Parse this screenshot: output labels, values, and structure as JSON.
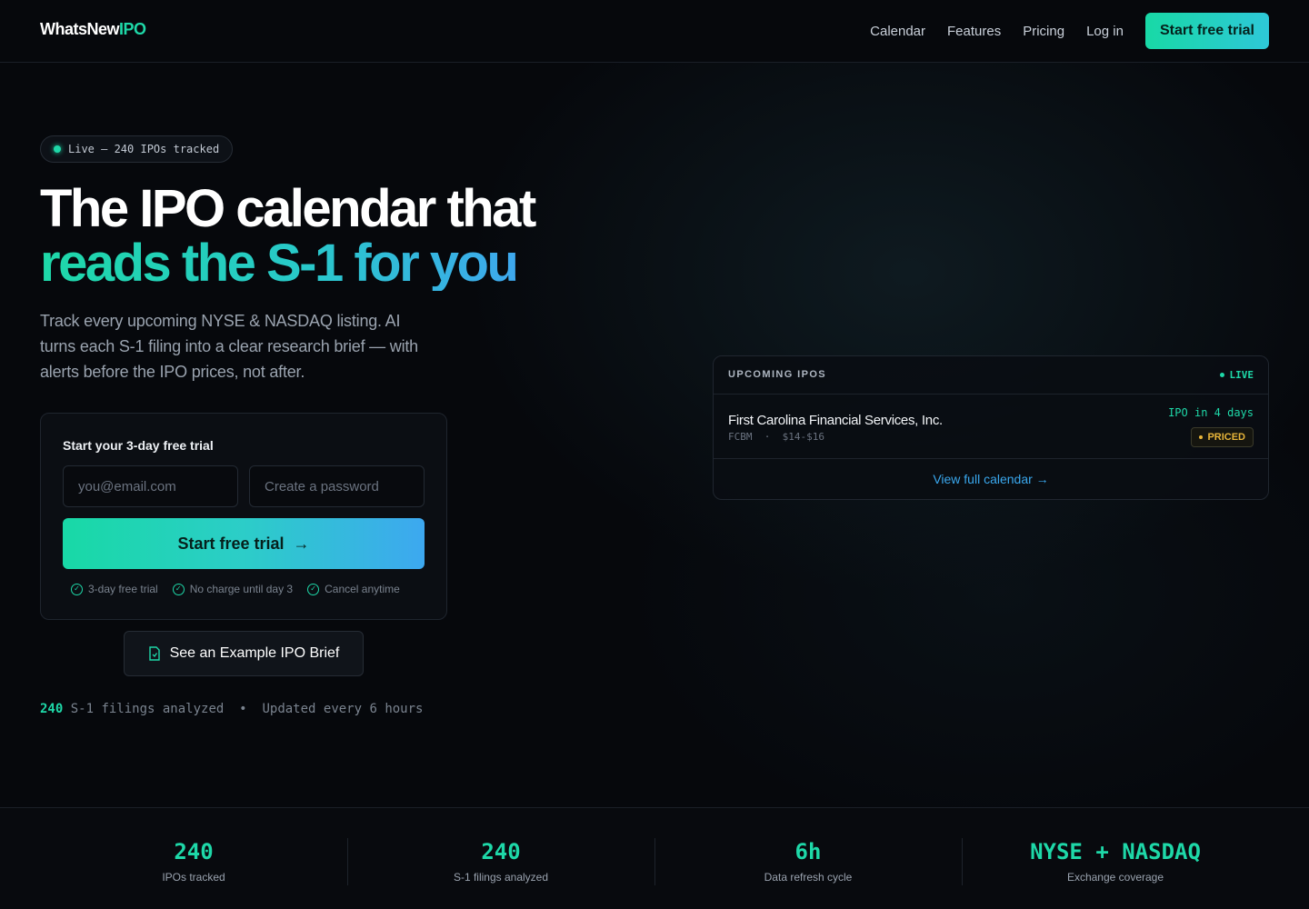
{
  "nav": {
    "logo_main": "WhatsNew",
    "logo_accent": "IPO",
    "links": [
      "Calendar",
      "Features",
      "Pricing",
      "Log in"
    ],
    "cta": "Start free trial"
  },
  "hero": {
    "live_badge": "Live — 240 IPOs tracked",
    "headline_line1": "The IPO calendar that",
    "headline_line2": "reads the S-1 for you",
    "subhead": "Track every upcoming NYSE & NASDAQ listing. AI turns each S-1 filing into a clear research brief — with alerts before the IPO prices, not after."
  },
  "signup": {
    "title": "Start your 3-day free trial",
    "email_placeholder": "you@email.com",
    "password_placeholder": "Create a password",
    "button_label": "Start free trial",
    "perks": [
      "3-day free trial",
      "No charge until day 3",
      "Cancel anytime"
    ]
  },
  "example_button": "See an Example IPO Brief",
  "stats_line": {
    "count": "240",
    "text": "S-1 filings analyzed",
    "separator": "•",
    "updated": "Updated every 6 hours"
  },
  "upcoming": {
    "title": "UPCOMING IPOS",
    "live_label": "LIVE",
    "rows": [
      {
        "name": "First Carolina Financial Services, Inc.",
        "ticker": "FCBM",
        "price_range": "$14-$16",
        "when": "IPO in 4 days",
        "status": "PRICED"
      }
    ],
    "view_all": "View full calendar →"
  },
  "stats": [
    {
      "value": "240",
      "label": "IPOs tracked"
    },
    {
      "value": "240",
      "label": "S-1 filings analyzed"
    },
    {
      "value": "6h",
      "label": "Data refresh cycle"
    },
    {
      "value": "NYSE + NASDAQ",
      "label": "Exchange coverage"
    }
  ],
  "colors": {
    "accent": "#1ed8a8",
    "accent_blue": "#3da8f0",
    "background": "#06080c",
    "priced": "#e8b53a"
  }
}
